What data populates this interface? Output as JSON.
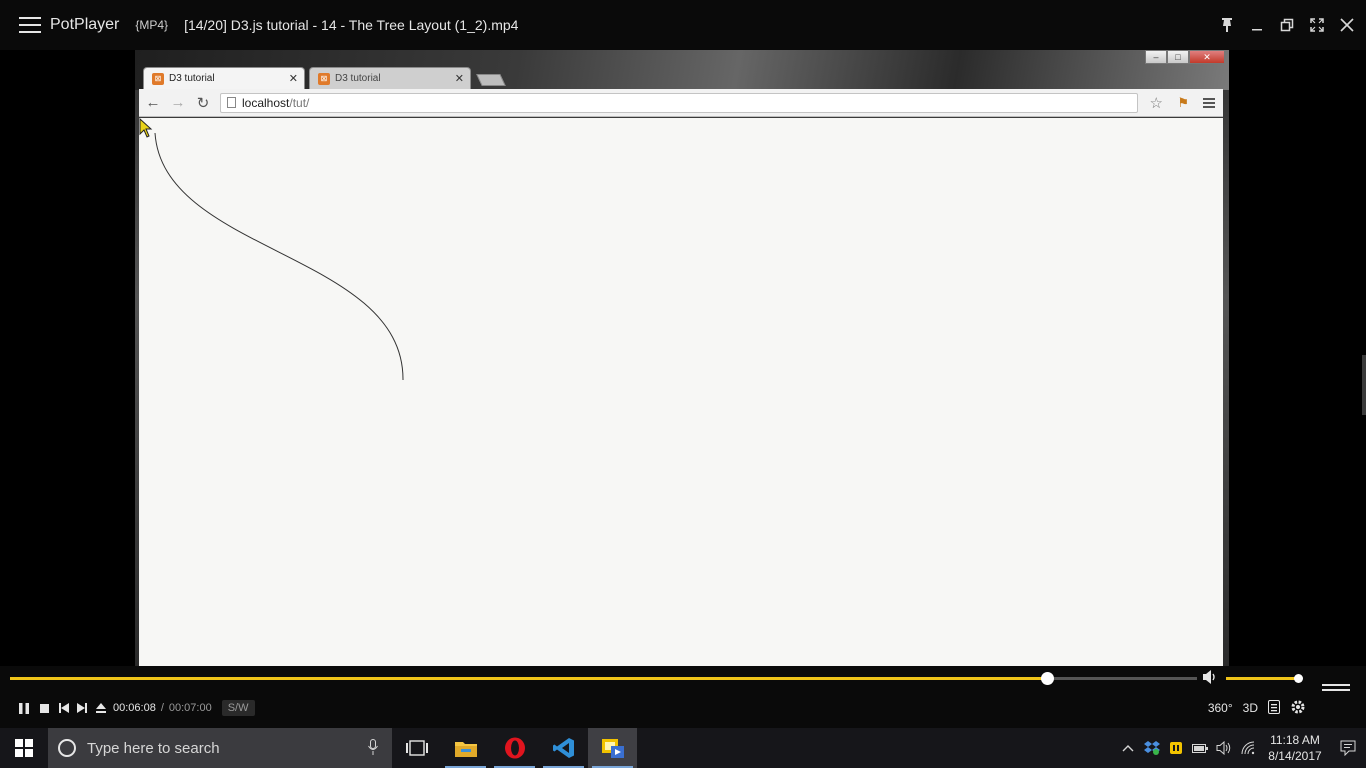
{
  "player": {
    "app_name": "PotPlayer",
    "format_badge": "{MP4}",
    "file_title": "[14/20] D3.js tutorial - 14 - The Tree Layout (1_2).mp4",
    "window_controls": [
      "pin-icon",
      "minimize-icon",
      "restore-icon",
      "fullscreen-icon",
      "close-icon"
    ],
    "progress_fraction": 0.874,
    "volume_fraction": 1.0,
    "time_current": "00:06:08",
    "time_separator": "/",
    "time_total": "00:07:00",
    "sw_label": "S/W",
    "right_controls": [
      "360°",
      "3D"
    ],
    "accent_color": "#f0c419"
  },
  "browser": {
    "tabs": [
      {
        "label": "D3 tutorial",
        "active": true
      },
      {
        "label": "D3 tutorial",
        "active": false
      }
    ],
    "url_host": "localhost",
    "url_path": "/tut/"
  },
  "taskbar": {
    "search_placeholder": "Type here to search",
    "apps": [
      "task-view-icon",
      "file-explorer-icon",
      "opera-icon",
      "vscode-icon",
      "potplayer-icon"
    ],
    "clock_time": "11:18 AM",
    "clock_date": "8/14/2017"
  }
}
